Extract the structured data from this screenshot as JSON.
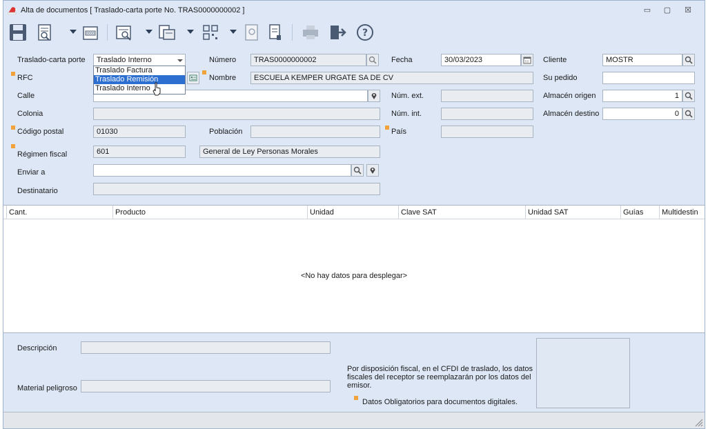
{
  "window": {
    "title": "Alta de documentos [ Traslado-carta porte No. TRAS0000000002 ]",
    "controls": {
      "minimize": "▭",
      "restore": "▢",
      "close": "☒"
    }
  },
  "toolbar": {
    "icons": [
      "save-icon",
      "preview-icon",
      "numbering-icon",
      "zoom-document-icon",
      "print-setup-icon",
      "barcode-icon",
      "stamp-icon",
      "attach-document-icon",
      "printer-icon",
      "exit-icon",
      "help-icon"
    ]
  },
  "form": {
    "tipo": {
      "label": "Traslado-carta porte",
      "value": "Traslado Interno",
      "options": [
        "Traslado Factura",
        "Traslado Remisión",
        "Traslado Interno"
      ],
      "highlighted": "Traslado Remisión"
    },
    "numero": {
      "label": "Número",
      "value": "TRAS0000000002"
    },
    "fecha": {
      "label": "Fecha",
      "value": "30/03/2023"
    },
    "cliente": {
      "label": "Cliente",
      "value": "MOSTR"
    },
    "rfc": {
      "label": "RFC",
      "value": ""
    },
    "nombre": {
      "label": "Nombre",
      "value": "ESCUELA KEMPER URGATE SA DE CV"
    },
    "su_pedido": {
      "label": "Su pedido",
      "value": ""
    },
    "calle": {
      "label": "Calle",
      "value": ""
    },
    "num_ext": {
      "label": "Núm. ext.",
      "value": ""
    },
    "almacen_origen": {
      "label": "Almacén origen",
      "value": "1"
    },
    "colonia": {
      "label": "Colonia",
      "value": ""
    },
    "num_int": {
      "label": "Núm. int.",
      "value": ""
    },
    "almacen_destino": {
      "label": "Almacén destino",
      "value": "0"
    },
    "codigo_postal": {
      "label": "Código postal",
      "value": "01030"
    },
    "poblacion": {
      "label": "Población",
      "value": ""
    },
    "pais": {
      "label": "País",
      "value": ""
    },
    "regimen_fiscal": {
      "label": "Régimen fiscal",
      "value": "601",
      "description": "General de Ley Personas Morales"
    },
    "enviar_a": {
      "label": "Enviar a",
      "value": ""
    },
    "destinatario": {
      "label": "Destinatario",
      "value": ""
    }
  },
  "grid": {
    "columns": [
      "Cant.",
      "Producto",
      "Unidad",
      "Clave SAT",
      "Unidad SAT",
      "Guías",
      "Multidestin"
    ],
    "empty_text": "<No hay datos para desplegar>"
  },
  "footer": {
    "descripcion": {
      "label": "Descripción",
      "value": ""
    },
    "material_peligroso": {
      "label": "Material peligroso",
      "value": ""
    },
    "note": "Por disposición fiscal, en el CFDI de traslado, los datos fiscales del receptor se reemplazarán por los datos del emisor.",
    "legend": "Datos Obligatorios para documentos digitales."
  },
  "colors": {
    "required_marker": "#f2a23a",
    "selection": "#2c6fd1",
    "window_bg": "#dde7f5"
  }
}
